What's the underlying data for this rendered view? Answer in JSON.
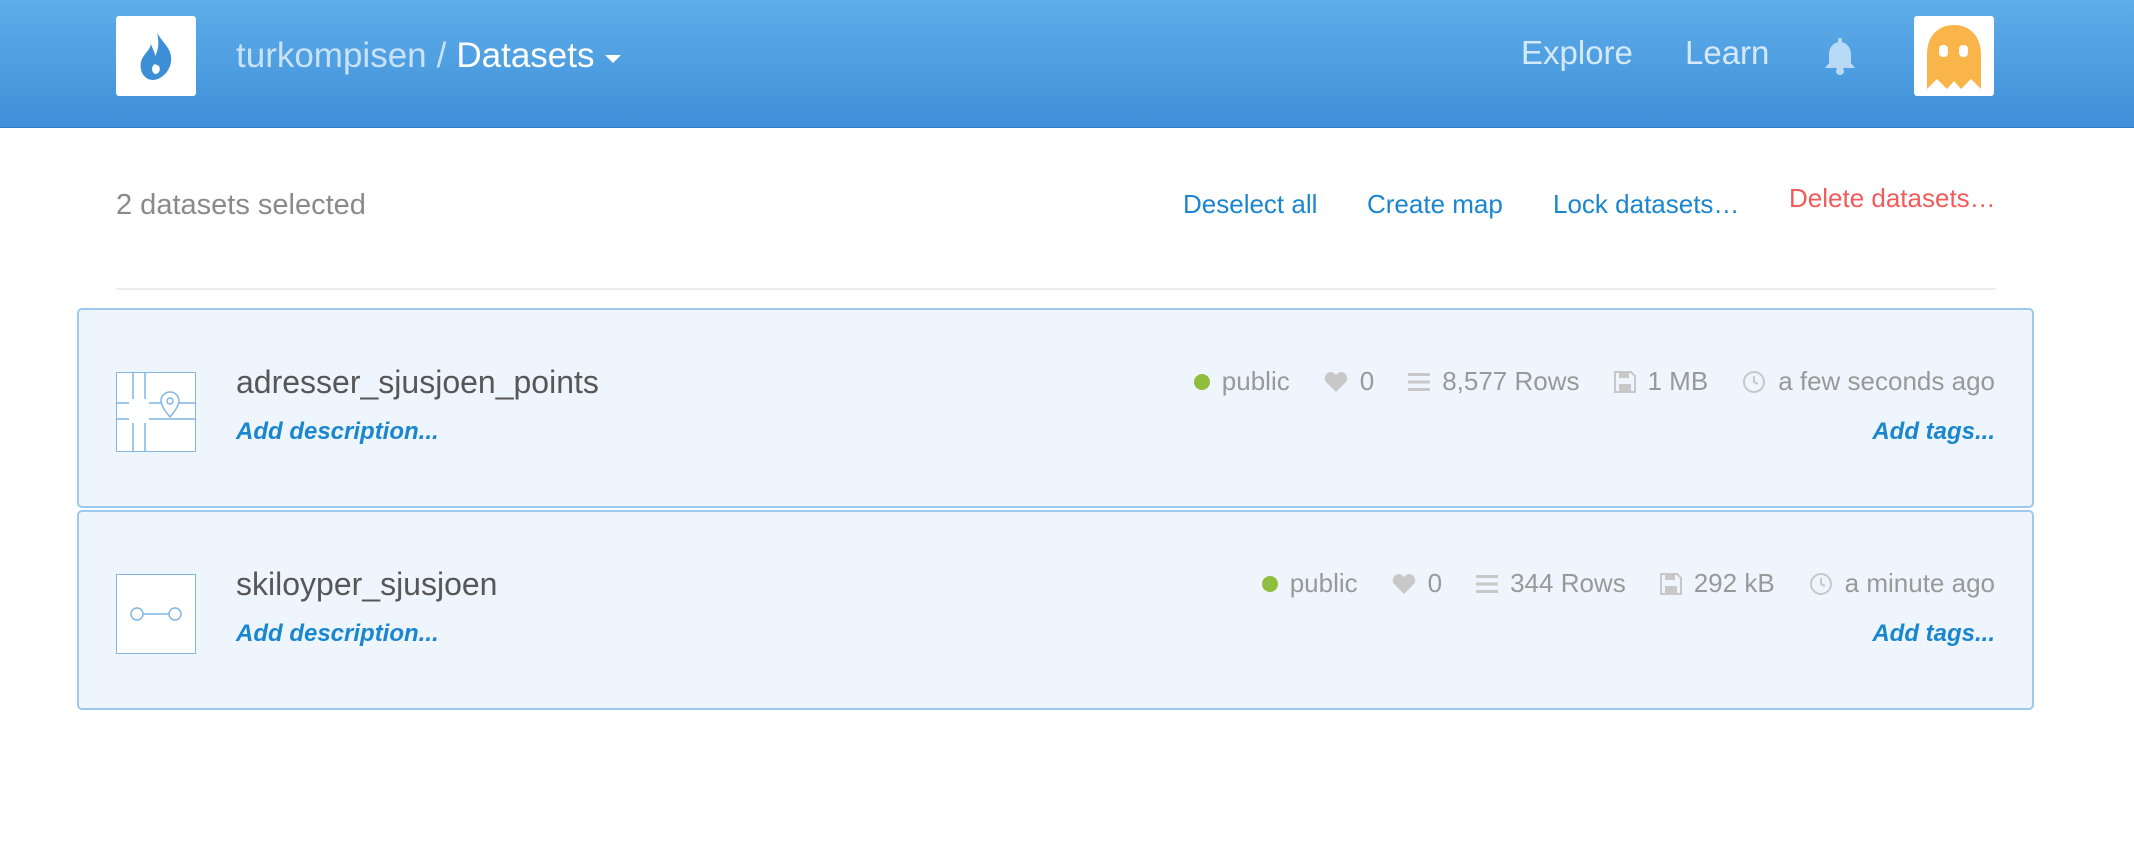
{
  "header": {
    "user": "turkompisen",
    "separator": "/",
    "section": "Datasets",
    "nav": {
      "explore": "Explore",
      "learn": "Learn"
    },
    "icons": {
      "logo": "flame-icon",
      "bell": "bell-icon",
      "avatar": "ghost-avatar"
    }
  },
  "selection": {
    "count_text": "2 datasets selected",
    "actions": {
      "deselect": "Deselect all",
      "create_map": "Create map",
      "lock": "Lock datasets…",
      "delete": "Delete datasets…"
    }
  },
  "datasets": [
    {
      "name": "adresser_sjusjoen_points",
      "description": "Add description...",
      "privacy": "public",
      "likes": "0",
      "rows": "8,577 Rows",
      "size": "1 MB",
      "updated": "a few seconds ago",
      "tags": "Add tags...",
      "thumb_icon": "map-pin-icon"
    },
    {
      "name": "skiloyper_sjusjoen",
      "description": "Add description...",
      "privacy": "public",
      "likes": "0",
      "rows": "344 Rows",
      "size": "292 kB",
      "updated": "a minute ago",
      "tags": "Add tags...",
      "thumb_icon": "line-icon"
    }
  ],
  "colors": {
    "header_gradient_top": "#5eaeea",
    "header_gradient_bottom": "#3f8fd9",
    "link": "#1a86d0",
    "danger": "#f25b5b",
    "public_dot": "#8fbd3d",
    "card_bg": "#eef5fc",
    "card_border": "#9cc9ec",
    "avatar": "#f9b54a"
  }
}
